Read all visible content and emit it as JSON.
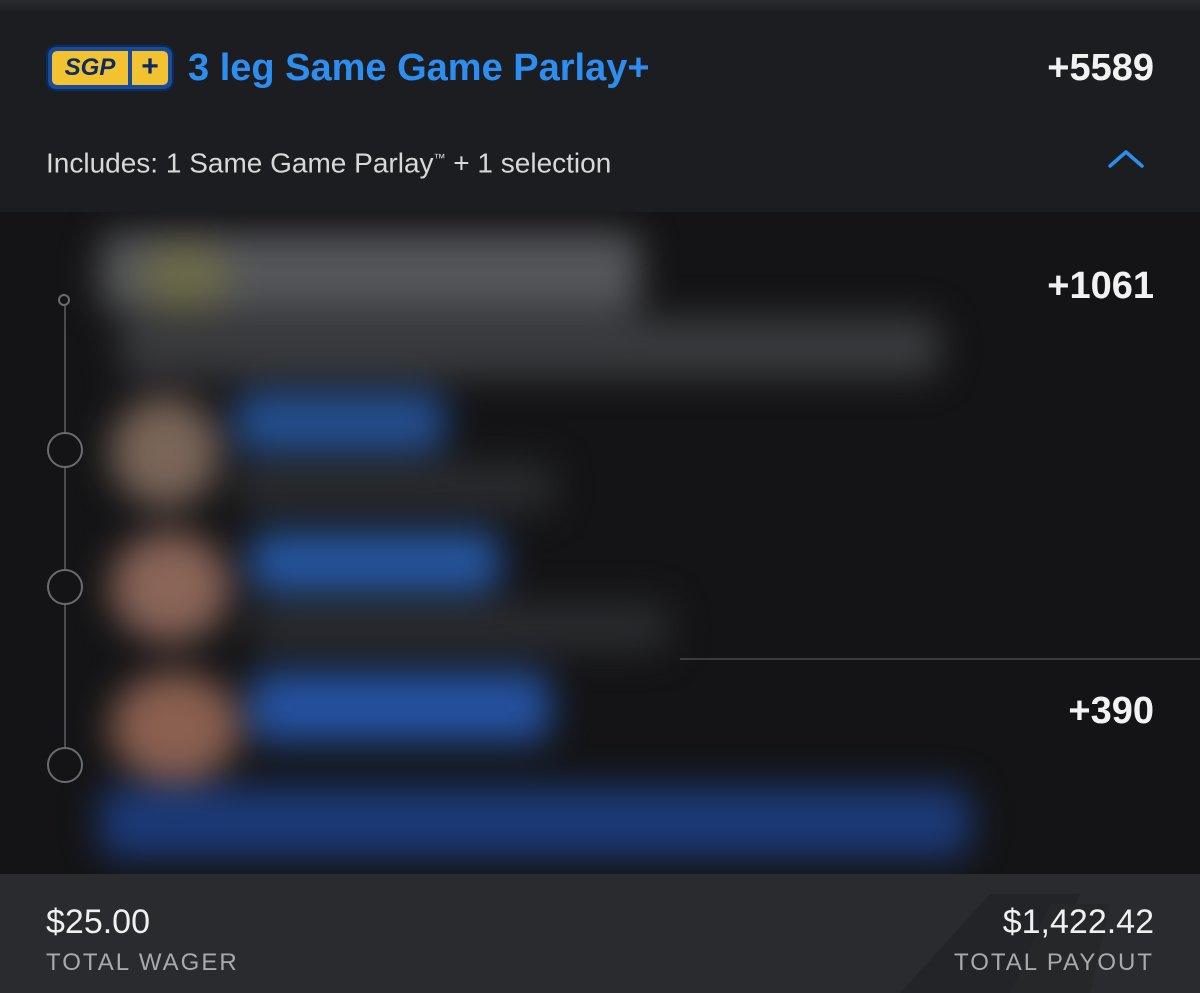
{
  "header": {
    "badge_sgp": "SGP",
    "badge_plus": "+",
    "title": "3 leg Same Game Parlay+",
    "odds": "+5589",
    "includes_text": "Includes: 1 Same Game Parlay",
    "includes_tm": "™",
    "includes_suffix": " + 1 selection",
    "collapse_icon": "chevron-up-icon"
  },
  "legs": [
    {
      "odds": "+1061"
    },
    {
      "odds": "+390"
    }
  ],
  "footer": {
    "total_wager": "$25.00",
    "total_wager_label": "TOTAL WAGER",
    "total_payout": "$1,422.42",
    "total_payout_label": "TOTAL PAYOUT"
  },
  "colors": {
    "accent_blue": "#2d8ef2",
    "badge_yellow": "#f2c230",
    "badge_navy": "#0b2a66",
    "background": "#1b1c1e",
    "footer_bg": "#2a2b2e"
  }
}
